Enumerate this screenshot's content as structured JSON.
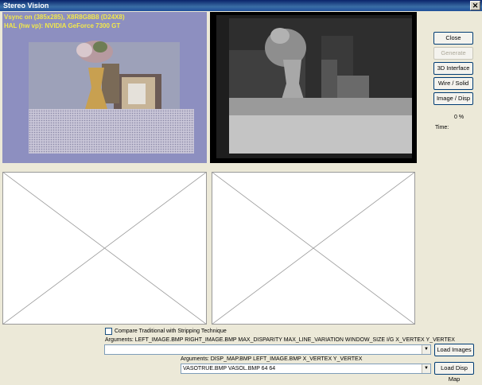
{
  "window": {
    "title": "Stereo Vision",
    "close_glyph": "✕"
  },
  "hud": {
    "line1": "Vsync on (385x285), X8R8G8B8 (D24X8)",
    "line2": "HAL (hw vp): NVIDIA GeForce 7300 GT"
  },
  "buttons": {
    "close": "Close",
    "generate": "Generate",
    "interface_3d": "3D Interface",
    "wire_solid": "Wire / Solid",
    "image_disp": "Image / Disp",
    "load_images": "Load Images",
    "load_disp_map": "Load Disp Map"
  },
  "status": {
    "percent": "0 %",
    "time_label": "Time:"
  },
  "compare": {
    "label": "Compare Traditional with Stripping Technique",
    "checked": false
  },
  "args1": {
    "label": "Arguments: LEFT_IMAGE.BMP RIGHT_IMAGE.BMP MAX_DISPARITY MAX_LINE_VARIATION WINDOW_SIZE I/G X_VERTEX Y_VERTEX",
    "value": ""
  },
  "args2": {
    "label": "Arguments: DISP_MAP.BMP LEFT_IMAGE.BMP X_VERTEX Y_VERTEX",
    "value": "VASOTRUE.BMP VASOL.BMP 64 64"
  },
  "icons": {
    "dropdown": "▼"
  }
}
